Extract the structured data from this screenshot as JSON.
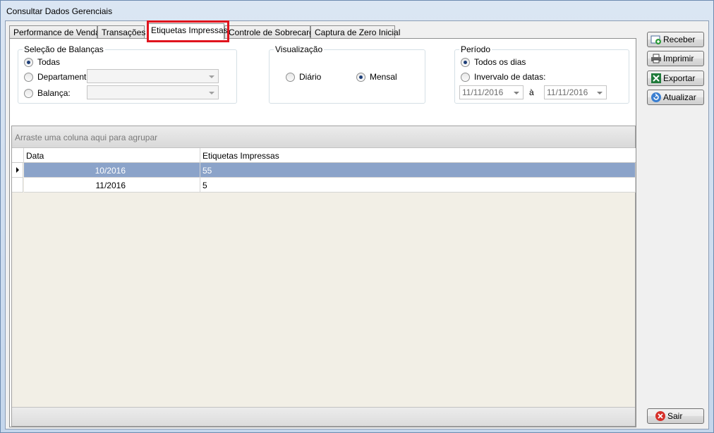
{
  "window": {
    "title": "Consultar Dados Gerenciais"
  },
  "tabs": [
    {
      "label": "Performance de Vendas"
    },
    {
      "label": "Transações"
    },
    {
      "label": "Etiquetas Impressas"
    },
    {
      "label": "Controle de Sobrecarga"
    },
    {
      "label": "Captura de Zero Inicial"
    }
  ],
  "balancas": {
    "legend": "Seleção de Balanças",
    "todas_label": "Todas",
    "departamento_label": "Departamento:",
    "balanca_label": "Balança:",
    "departamento_value": "",
    "balanca_value": ""
  },
  "visualizacao": {
    "legend": "Visualização",
    "diario_label": "Diário",
    "mensal_label": "Mensal"
  },
  "periodo": {
    "legend": "Período",
    "todos_label": "Todos os dias",
    "intervalo_label": "Invervalo de datas:",
    "date_from": "11/11/2016",
    "sep": "à",
    "date_to": "11/11/2016"
  },
  "grid": {
    "group_hint": "Arraste uma coluna aqui para agrupar",
    "columns": [
      "Data",
      "Etiquetas Impressas"
    ],
    "rows": [
      {
        "data": "10/2016",
        "etiquetas": "55"
      },
      {
        "data": "11/2016",
        "etiquetas": "5"
      }
    ]
  },
  "buttons": {
    "receber": "Receber",
    "imprimir": "Imprimir",
    "exportar": "Exportar",
    "atualizar": "Atualizar",
    "sair": "Sair"
  },
  "colors": {
    "highlight": "#e0141e",
    "selected_row": "#8ba3c9"
  }
}
